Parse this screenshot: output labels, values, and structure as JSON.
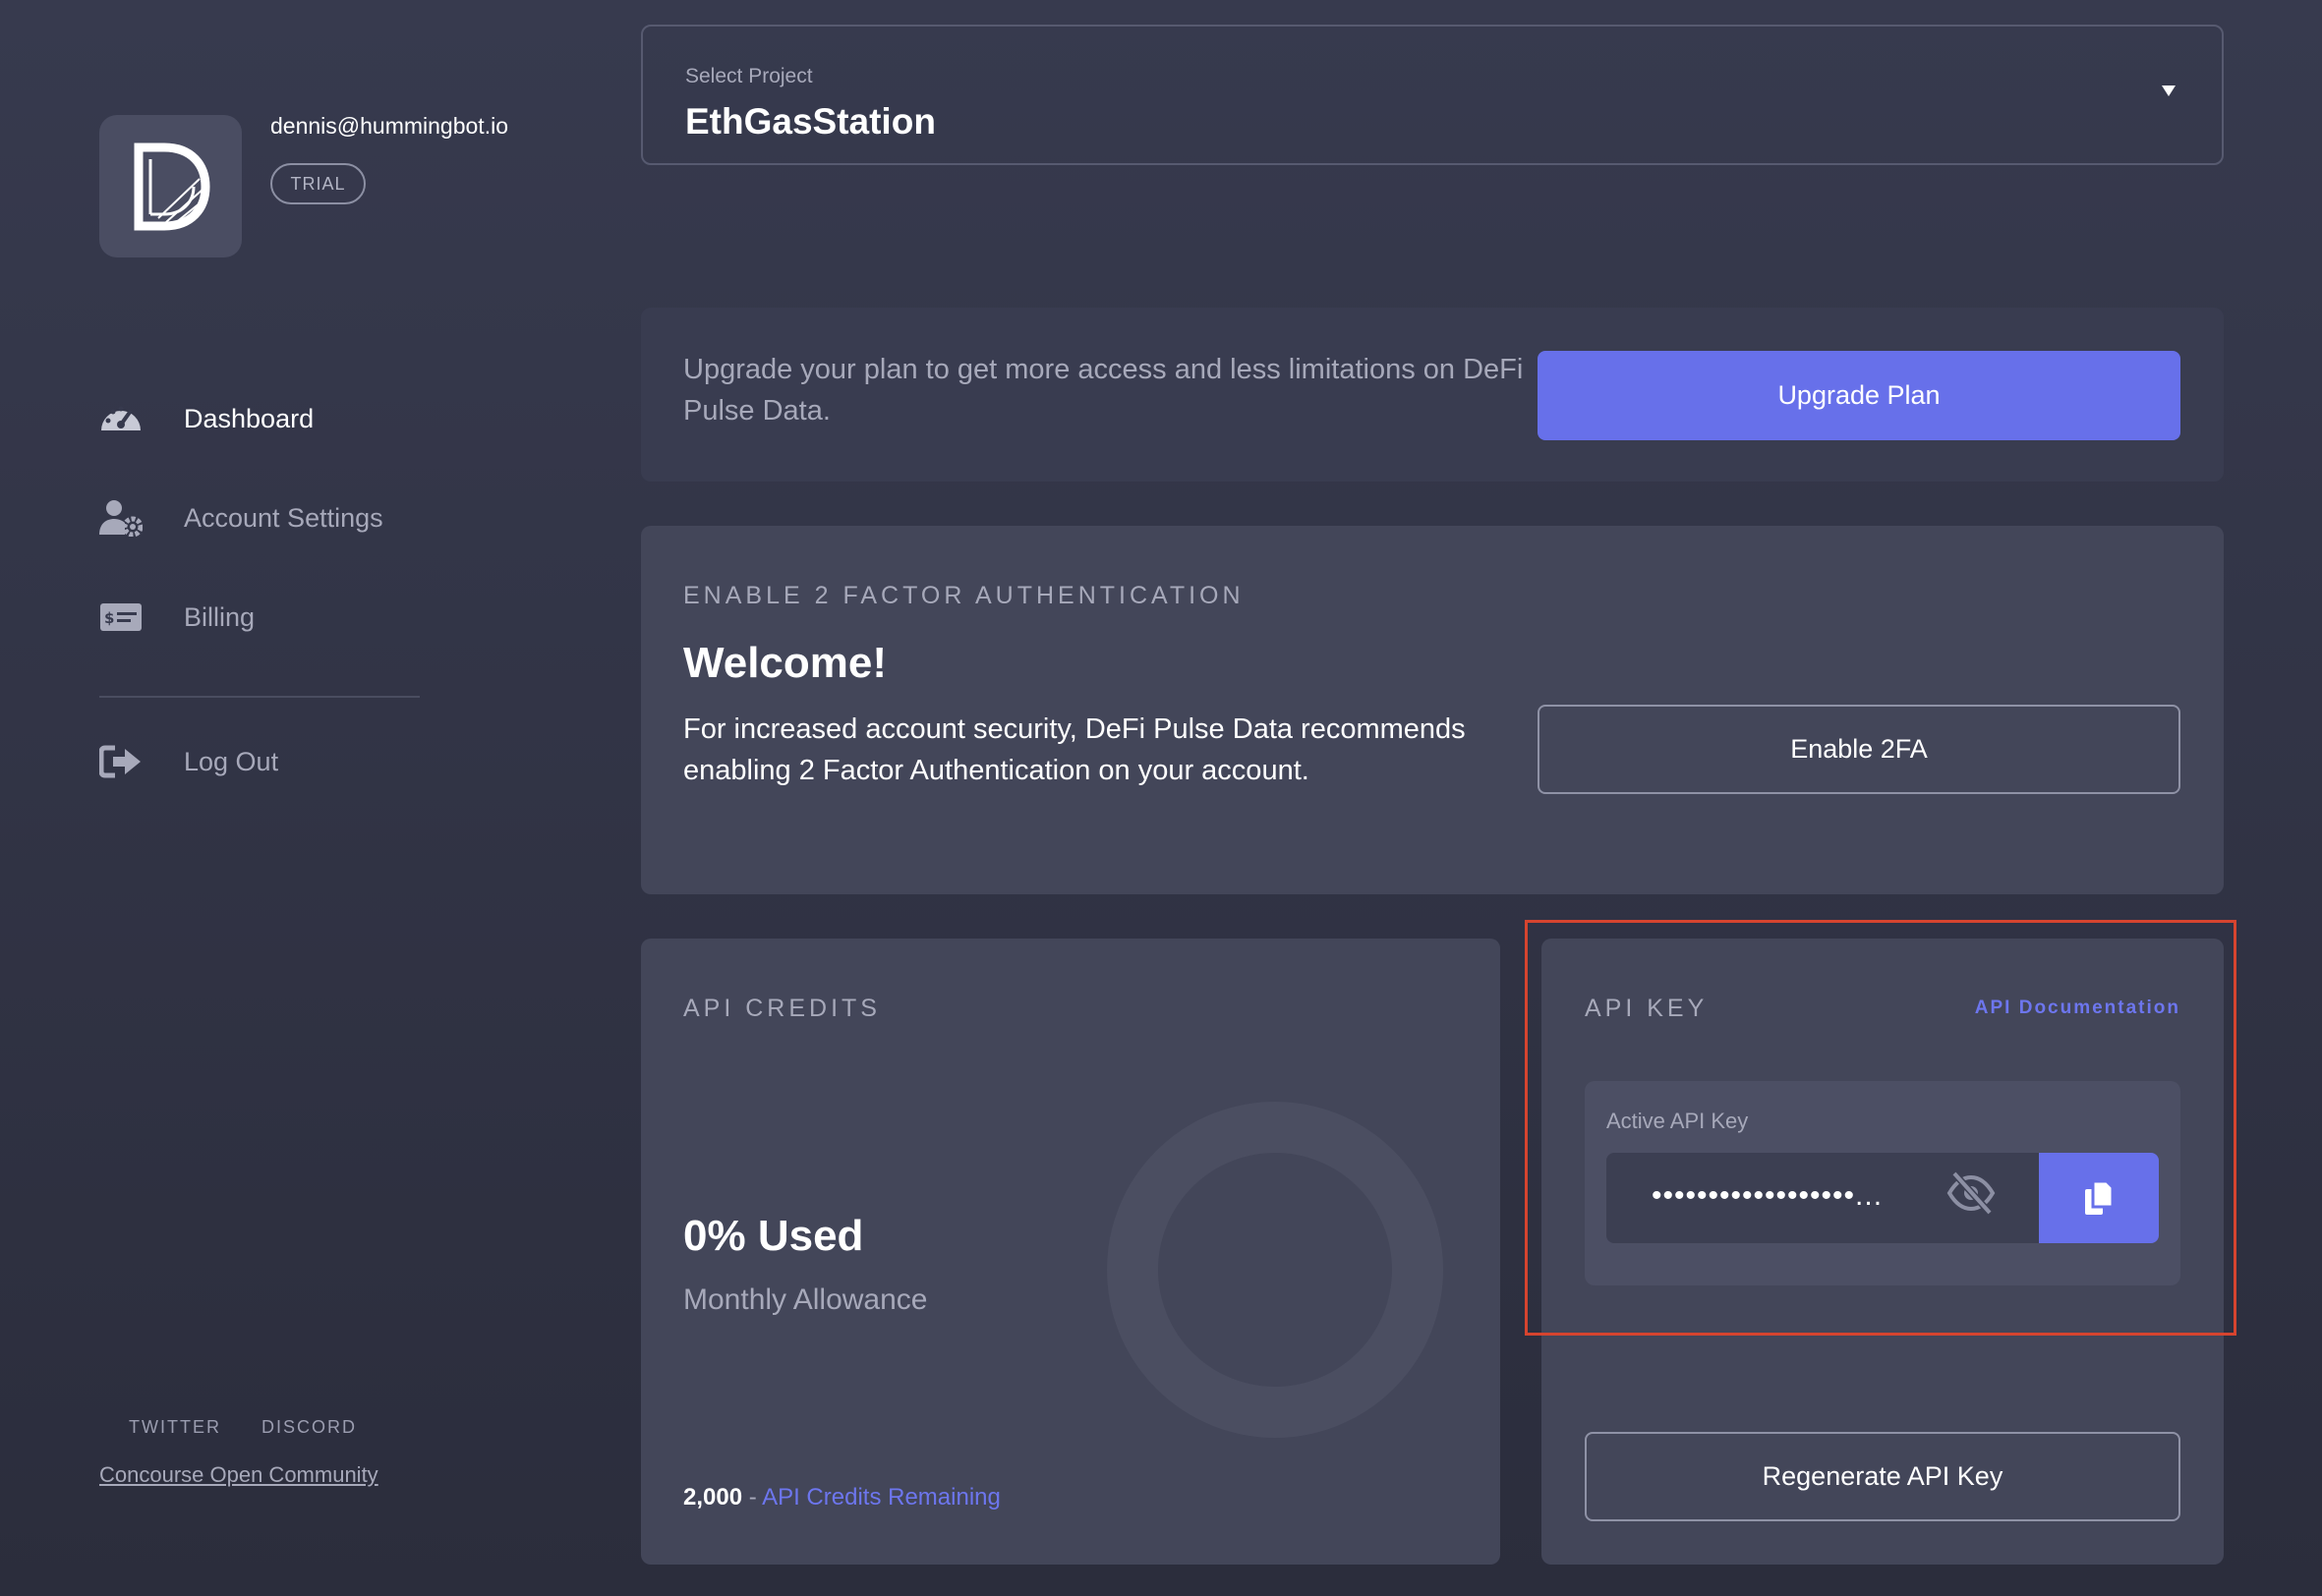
{
  "user": {
    "email": "dennis@hummingbot.io",
    "plan_badge": "TRIAL",
    "avatar_letter": "D"
  },
  "sidebar": {
    "items": [
      {
        "label": "Dashboard",
        "icon": "dashboard-gauge-icon",
        "active": true
      },
      {
        "label": "Account Settings",
        "icon": "user-cog-icon",
        "active": false
      },
      {
        "label": "Billing",
        "icon": "billing-card-icon",
        "active": false
      }
    ],
    "logout": {
      "label": "Log Out",
      "icon": "sign-out-icon"
    },
    "footer": {
      "twitter": "TWITTER",
      "discord": "DISCORD",
      "community": "Concourse Open Community"
    }
  },
  "project_select": {
    "label": "Select Project",
    "value": "EthGasStation"
  },
  "upgrade": {
    "text": "Upgrade your plan to get more access and less limitations on DeFi Pulse Data.",
    "button": "Upgrade Plan"
  },
  "twofa": {
    "heading": "ENABLE 2 FACTOR AUTHENTICATION",
    "title": "Welcome!",
    "text": "For increased account security, DeFi Pulse Data recommends enabling 2 Factor Authentication on your account.",
    "button": "Enable 2FA"
  },
  "api_credits": {
    "heading": "API CREDITS",
    "used_label": "0% Used",
    "used_percent": 0,
    "subtitle": "Monthly Allowance",
    "remaining_value": "2,000",
    "separator": "-",
    "remaining_label": "API Credits Remaining"
  },
  "api_key": {
    "heading": "API KEY",
    "doc_link": "API Documentation",
    "field_label": "Active API Key",
    "masked_value": "••••••••••••••••••...",
    "regenerate_button": "Regenerate API Key"
  },
  "colors": {
    "accent": "#6770ea",
    "link": "#6d76ee",
    "highlight": "#d6442f"
  }
}
